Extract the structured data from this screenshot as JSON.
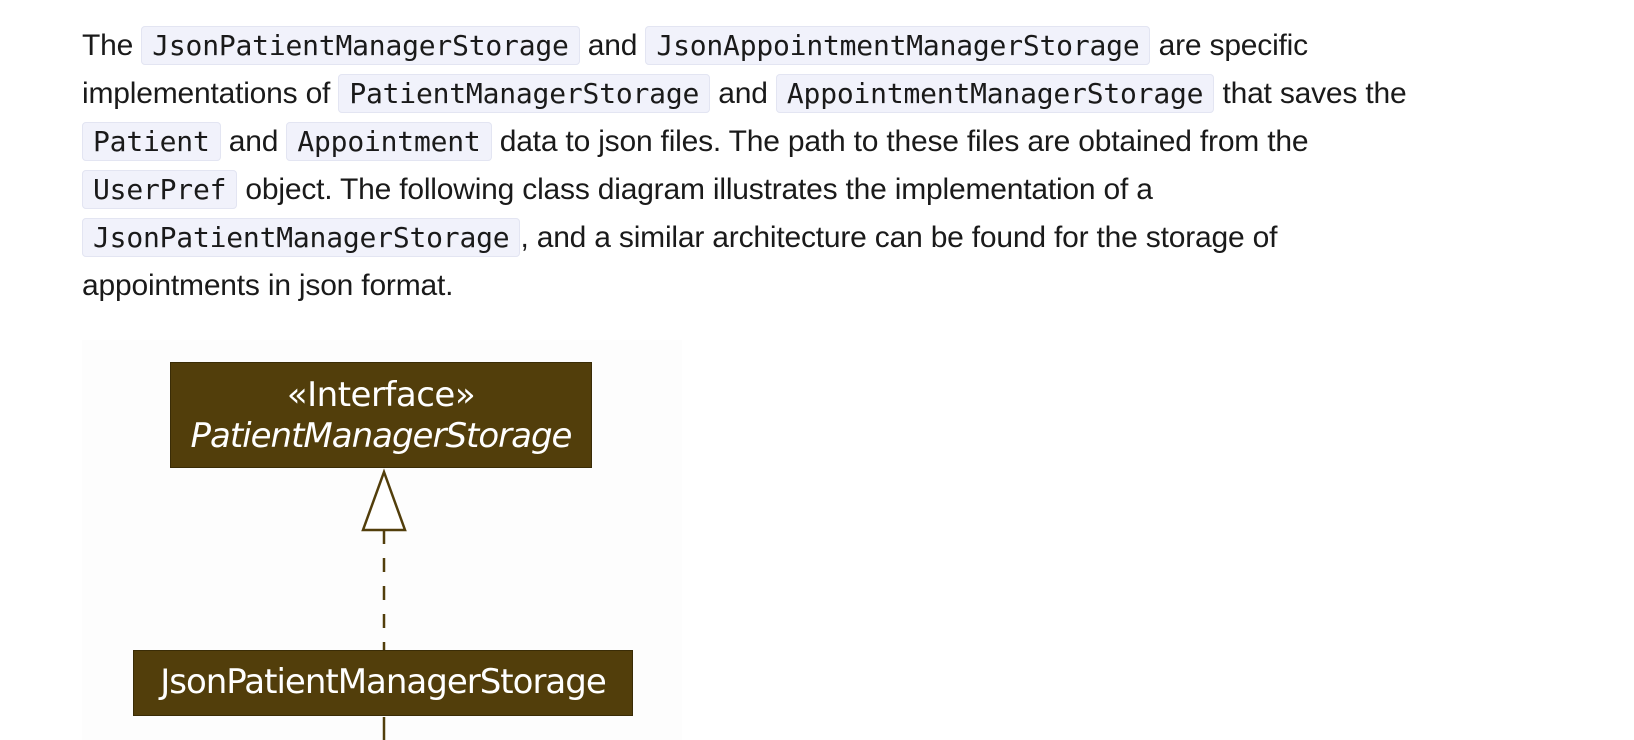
{
  "paragraph": {
    "line1": {
      "t1": "The ",
      "c1": "JsonPatientManagerStorage",
      "t2": " and ",
      "c2": "JsonAppointmentManagerStorage",
      "t3": " are specific"
    },
    "line2": {
      "t1": "implementations of ",
      "c1": "PatientManagerStorage",
      "t2": " and ",
      "c2": "AppointmentManagerStorage",
      "t3": " that saves the"
    },
    "line3": {
      "c1": "Patient",
      "t1": " and ",
      "c2": "Appointment",
      "t2": " data to json files. The path to these files are obtained from the"
    },
    "line4": {
      "c1": "UserPref",
      "t1": " object. The following class diagram illustrates the implementation of a"
    },
    "line5": {
      "c1": "JsonPatientManagerStorage",
      "t1": ", and a similar architecture can be found for the storage of"
    },
    "line6": {
      "t1": "appointments in json format."
    }
  },
  "diagram": {
    "interface": {
      "stereotype": "«Interface»",
      "name": "PatientManagerStorage"
    },
    "implementation": {
      "name": "JsonPatientManagerStorage"
    },
    "colors": {
      "box_fill": "#523e0b",
      "line": "#523e0b",
      "text": "#ffffff"
    },
    "relation": "realization"
  }
}
